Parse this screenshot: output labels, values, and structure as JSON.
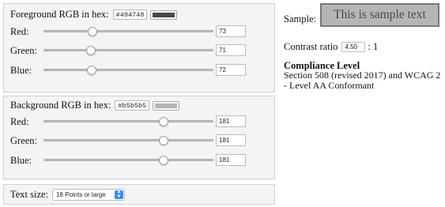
{
  "foreground": {
    "header": "Foreground RGB in hex:",
    "hex": "#494748",
    "color": "#494748",
    "channels": [
      {
        "label": "Red:",
        "value": "73"
      },
      {
        "label": "Green:",
        "value": "71"
      },
      {
        "label": "Blue:",
        "value": "72"
      }
    ]
  },
  "background": {
    "header": "Background RGB in hex:",
    "hex": "#b5b5b5",
    "color": "#b5b5b5",
    "channels": [
      {
        "label": "Red:",
        "value": "181"
      },
      {
        "label": "Green:",
        "value": "181"
      },
      {
        "label": "Blue:",
        "value": "181"
      }
    ]
  },
  "text_size": {
    "label": "Text size:",
    "selected": "18 Points or large"
  },
  "sample": {
    "label": "Sample:",
    "text": "This is sample text"
  },
  "contrast": {
    "label": "Contrast ratio",
    "value": "4.50",
    "suffix": ": 1"
  },
  "compliance": {
    "title": "Compliance Level",
    "text": "Section 508 (revised 2017) and WCAG 2 - Level AA Conformant"
  }
}
